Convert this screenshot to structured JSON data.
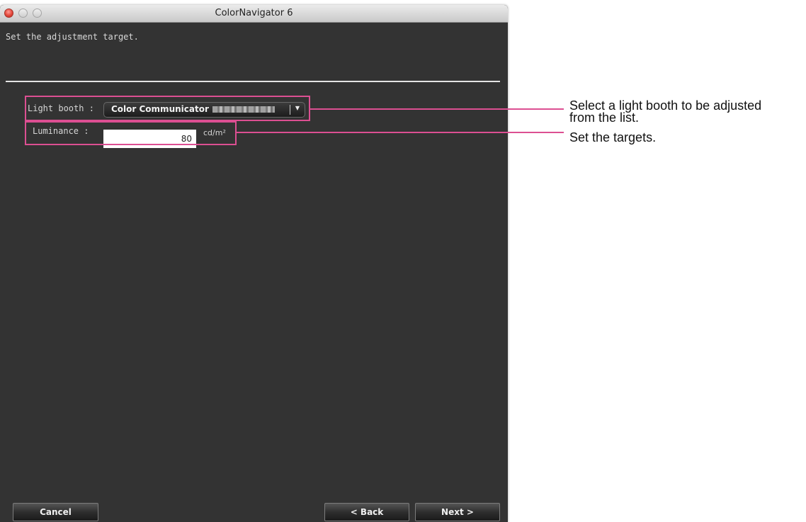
{
  "window": {
    "title": "ColorNavigator 6"
  },
  "instruction": "Set the adjustment target.",
  "light_booth": {
    "label": "Light booth :",
    "selected": "Color Communicator",
    "value_obscured": true,
    "arrow_glyph": "▼"
  },
  "luminance": {
    "label": "Luminance :",
    "value": "80",
    "unit": "cd/m²"
  },
  "callouts": {
    "light_booth": "Select a light booth to be adjusted\nfrom the list.",
    "targets": "Set the targets."
  },
  "buttons": {
    "cancel": "Cancel",
    "back": "< Back",
    "next": "Next >"
  },
  "colors": {
    "window_bg": "#333333",
    "highlight": "#dc4f92",
    "close_button": "#e3473b"
  },
  "icons": {
    "close": "close-icon",
    "minimize": "minimize-icon",
    "zoom": "zoom-icon",
    "dropdown": "chevron-down-icon"
  }
}
